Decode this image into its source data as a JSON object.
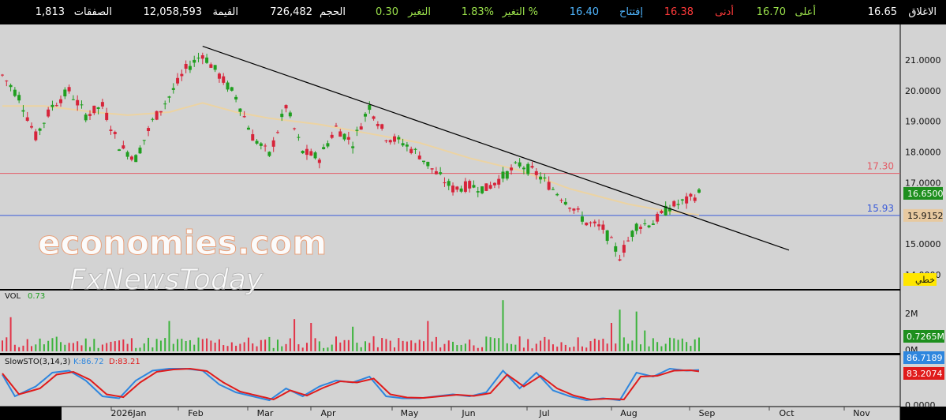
{
  "header": {
    "close_label": "الاغلاق",
    "close_value": "16.65",
    "high_label": "أعلى",
    "high_value": "16.70",
    "low_label": "أدنى",
    "low_value": "16.38",
    "open_label": "إفتتاح",
    "open_value": "16.40",
    "change_pct_label": "التغير %",
    "change_pct_value": "1.83%",
    "change_label": "التغير",
    "change_value": "0.30",
    "volume_label": "الحجم",
    "volume_value": "726,482",
    "value_label": "القيمة",
    "value_value": "12,058,593",
    "trades_label": "الصفقات",
    "trades_value": "1,813"
  },
  "watermark": {
    "line1": "economies.com",
    "line2": "FxNewsToday"
  },
  "colors": {
    "up": "#1f9e1f",
    "down": "#d6243a",
    "ma": "#ecd3a2",
    "resistance": "#e35b66",
    "support": "#3a5bd9",
    "k_line": "#2e86de",
    "d_line": "#e01b1b",
    "bg": "#d3d3d3"
  },
  "chart_data": [
    {
      "type": "candlestick",
      "ylim": [
        14,
        21.9
      ],
      "y_ticks": [
        "21.0000",
        "20.0000",
        "19.0000",
        "18.0000",
        "17.0000",
        "15.0000",
        "14.0000"
      ],
      "x_ticks": [
        "2026Jan",
        "Feb",
        "Mar",
        "Apr",
        "May",
        "Jun",
        "Jul",
        "Aug",
        "Sep",
        "Oct",
        "Nov"
      ],
      "last_price_label": "16.6500",
      "support_price_label": "15.9152",
      "trendline_label": "خطي",
      "resistance": {
        "value": 17.3,
        "label": "17.30"
      },
      "support": {
        "value": 15.93,
        "label": "15.93"
      },
      "trendline": {
        "from": [
          0,
          21.3
        ],
        "to": [
          185,
          14.8
        ]
      },
      "anchors": [
        [
          0,
          20.5
        ],
        [
          4,
          19.8
        ],
        [
          8,
          18.5
        ],
        [
          12,
          19.5
        ],
        [
          16,
          20.0
        ],
        [
          20,
          19.2
        ],
        [
          24,
          19.5
        ],
        [
          28,
          18.2
        ],
        [
          32,
          17.8
        ],
        [
          36,
          19.0
        ],
        [
          40,
          19.8
        ],
        [
          44,
          20.7
        ],
        [
          48,
          21.2
        ],
        [
          52,
          20.5
        ],
        [
          56,
          19.8
        ],
        [
          60,
          18.5
        ],
        [
          64,
          17.9
        ],
        [
          68,
          19.5
        ],
        [
          72,
          18.0
        ],
        [
          76,
          17.8
        ],
        [
          80,
          18.8
        ],
        [
          84,
          18.3
        ],
        [
          88,
          19.5
        ],
        [
          92,
          18.5
        ],
        [
          96,
          18.3
        ],
        [
          100,
          17.9
        ],
        [
          104,
          17.3
        ],
        [
          108,
          16.8
        ],
        [
          112,
          16.9
        ],
        [
          116,
          16.8
        ],
        [
          120,
          17.2
        ],
        [
          124,
          17.6
        ],
        [
          128,
          17.3
        ],
        [
          132,
          16.8
        ],
        [
          136,
          16.3
        ],
        [
          140,
          15.7
        ],
        [
          144,
          15.5
        ],
        [
          148,
          14.6
        ],
        [
          152,
          15.6
        ],
        [
          156,
          15.7
        ],
        [
          160,
          16.2
        ],
        [
          164,
          16.4
        ],
        [
          167,
          16.65
        ]
      ],
      "ma_anchors": [
        [
          0,
          19.5
        ],
        [
          10,
          19.5
        ],
        [
          22,
          19.3
        ],
        [
          30,
          19.2
        ],
        [
          40,
          19.3
        ],
        [
          48,
          19.6
        ],
        [
          56,
          19.3
        ],
        [
          64,
          19.1
        ],
        [
          76,
          18.9
        ],
        [
          88,
          18.6
        ],
        [
          100,
          18.3
        ],
        [
          112,
          17.8
        ],
        [
          124,
          17.4
        ],
        [
          136,
          16.8
        ],
        [
          150,
          16.3
        ],
        [
          160,
          16.05
        ],
        [
          167,
          15.95
        ]
      ],
      "bar_count": 168
    },
    {
      "type": "bar",
      "name": "VOL",
      "label": "VOL",
      "current_label": "0.73",
      "y_ticks": [
        "2M",
        "0M"
      ],
      "ylim": [
        0,
        3000000
      ],
      "current_value_label": "0.7265M",
      "last_value": 726482,
      "volume_spikes": [
        [
          2,
          1800000
        ],
        [
          40,
          1600000
        ],
        [
          70,
          1700000
        ],
        [
          74,
          1500000
        ],
        [
          84,
          1300000
        ],
        [
          102,
          1600000
        ],
        [
          120,
          2700000
        ],
        [
          146,
          1500000
        ],
        [
          148,
          2200000
        ],
        [
          152,
          2100000
        ],
        [
          154,
          1100000
        ]
      ]
    },
    {
      "type": "line",
      "name": "SlowSTO(3,14,3)",
      "label": "SlowSTO(3,14,3)",
      "k_label": "K:86.72",
      "d_label": "D:83.21",
      "k_value_label": "86.7189",
      "d_value_label": "83.2074",
      "zero_label": "0.0000",
      "ylim": [
        0,
        100
      ],
      "k_anchors": [
        [
          0,
          75
        ],
        [
          3,
          20
        ],
        [
          8,
          45
        ],
        [
          12,
          80
        ],
        [
          16,
          85
        ],
        [
          20,
          60
        ],
        [
          24,
          20
        ],
        [
          28,
          15
        ],
        [
          32,
          60
        ],
        [
          36,
          85
        ],
        [
          40,
          90
        ],
        [
          44,
          90
        ],
        [
          48,
          85
        ],
        [
          52,
          50
        ],
        [
          56,
          30
        ],
        [
          60,
          20
        ],
        [
          64,
          10
        ],
        [
          68,
          40
        ],
        [
          72,
          20
        ],
        [
          76,
          45
        ],
        [
          80,
          60
        ],
        [
          84,
          55
        ],
        [
          88,
          70
        ],
        [
          92,
          20
        ],
        [
          96,
          15
        ],
        [
          100,
          15
        ],
        [
          104,
          20
        ],
        [
          108,
          25
        ],
        [
          112,
          20
        ],
        [
          116,
          30
        ],
        [
          120,
          85
        ],
        [
          124,
          40
        ],
        [
          128,
          80
        ],
        [
          132,
          35
        ],
        [
          136,
          20
        ],
        [
          140,
          10
        ],
        [
          144,
          15
        ],
        [
          148,
          10
        ],
        [
          152,
          80
        ],
        [
          156,
          70
        ],
        [
          160,
          90
        ],
        [
          164,
          85
        ],
        [
          167,
          86.72
        ]
      ],
      "d_anchors": [
        [
          0,
          78
        ],
        [
          4,
          25
        ],
        [
          9,
          40
        ],
        [
          13,
          75
        ],
        [
          17,
          82
        ],
        [
          21,
          62
        ],
        [
          25,
          25
        ],
        [
          29,
          18
        ],
        [
          33,
          55
        ],
        [
          37,
          82
        ],
        [
          41,
          88
        ],
        [
          45,
          90
        ],
        [
          49,
          84
        ],
        [
          53,
          55
        ],
        [
          57,
          32
        ],
        [
          61,
          22
        ],
        [
          65,
          12
        ],
        [
          69,
          35
        ],
        [
          73,
          22
        ],
        [
          77,
          42
        ],
        [
          81,
          58
        ],
        [
          85,
          55
        ],
        [
          89,
          65
        ],
        [
          93,
          25
        ],
        [
          97,
          17
        ],
        [
          101,
          16
        ],
        [
          105,
          20
        ],
        [
          109,
          24
        ],
        [
          113,
          21
        ],
        [
          117,
          28
        ],
        [
          121,
          75
        ],
        [
          125,
          45
        ],
        [
          129,
          72
        ],
        [
          133,
          40
        ],
        [
          137,
          22
        ],
        [
          141,
          12
        ],
        [
          145,
          14
        ],
        [
          149,
          12
        ],
        [
          153,
          70
        ],
        [
          157,
          72
        ],
        [
          161,
          85
        ],
        [
          165,
          86
        ],
        [
          167,
          83.21
        ]
      ]
    }
  ]
}
